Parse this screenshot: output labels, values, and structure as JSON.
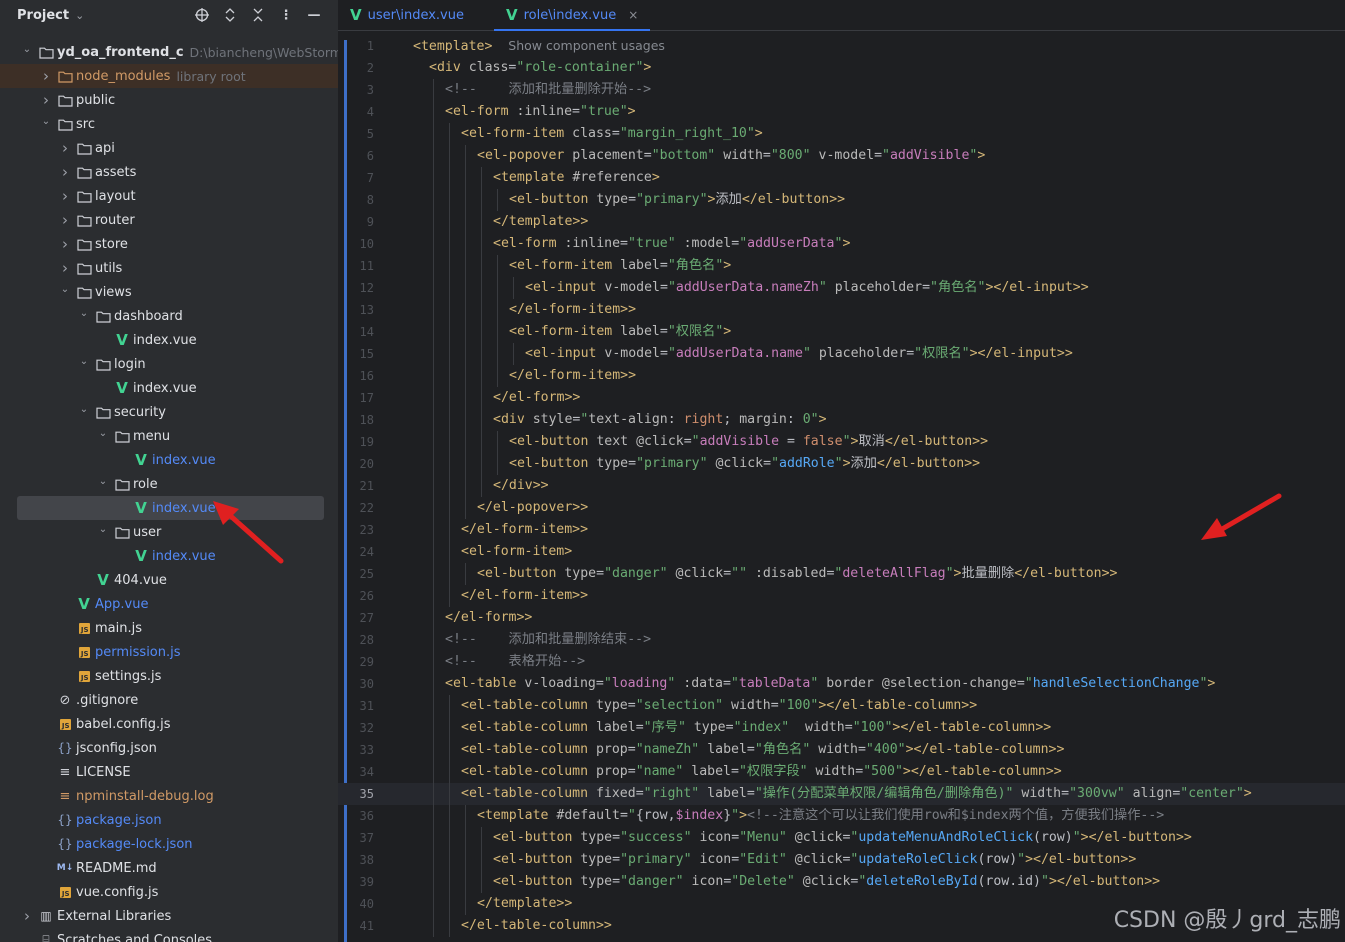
{
  "project_panel": {
    "title": "Project",
    "tools": [
      "crosshair-icon",
      "expand-icon",
      "collapse-icon",
      "more-icon",
      "minimize-icon"
    ]
  },
  "tree": [
    {
      "depth": 0,
      "arrow": "down",
      "icon": "folder",
      "label": "yd_oa_frontend_c",
      "sub": "D:\\biancheng\\WebStormProj",
      "bold": true
    },
    {
      "depth": 1,
      "arrow": "right",
      "icon": "folder-excluded",
      "label": "node_modules",
      "sub": "library root",
      "variant": "excluded"
    },
    {
      "depth": 1,
      "arrow": "right",
      "icon": "folder",
      "label": "public"
    },
    {
      "depth": 1,
      "arrow": "down",
      "icon": "folder",
      "label": "src"
    },
    {
      "depth": 2,
      "arrow": "right",
      "icon": "folder",
      "label": "api"
    },
    {
      "depth": 2,
      "arrow": "right",
      "icon": "folder",
      "label": "assets"
    },
    {
      "depth": 2,
      "arrow": "right",
      "icon": "folder",
      "label": "layout"
    },
    {
      "depth": 2,
      "arrow": "right",
      "icon": "folder",
      "label": "router"
    },
    {
      "depth": 2,
      "arrow": "right",
      "icon": "folder",
      "label": "store"
    },
    {
      "depth": 2,
      "arrow": "right",
      "icon": "folder",
      "label": "utils"
    },
    {
      "depth": 2,
      "arrow": "down",
      "icon": "folder",
      "label": "views"
    },
    {
      "depth": 3,
      "arrow": "down",
      "icon": "folder",
      "label": "dashboard"
    },
    {
      "depth": 4,
      "arrow": "none",
      "icon": "vue",
      "label": "index.vue"
    },
    {
      "depth": 3,
      "arrow": "down",
      "icon": "folder",
      "label": "login"
    },
    {
      "depth": 4,
      "arrow": "none",
      "icon": "vue",
      "label": "index.vue"
    },
    {
      "depth": 3,
      "arrow": "down",
      "icon": "folder",
      "label": "security"
    },
    {
      "depth": 4,
      "arrow": "down",
      "icon": "folder",
      "label": "menu"
    },
    {
      "depth": 5,
      "arrow": "none",
      "icon": "vue",
      "label": "index.vue",
      "color": "blue"
    },
    {
      "depth": 4,
      "arrow": "down",
      "icon": "folder",
      "label": "role"
    },
    {
      "depth": 5,
      "arrow": "none",
      "icon": "vue",
      "label": "index.vue",
      "color": "blue",
      "selected": true
    },
    {
      "depth": 4,
      "arrow": "down",
      "icon": "folder",
      "label": "user"
    },
    {
      "depth": 5,
      "arrow": "none",
      "icon": "vue",
      "label": "index.vue",
      "color": "blue"
    },
    {
      "depth": 3,
      "arrow": "none",
      "icon": "vue",
      "label": "404.vue"
    },
    {
      "depth": 2,
      "arrow": "none",
      "icon": "vue",
      "label": "App.vue",
      "color": "blue"
    },
    {
      "depth": 2,
      "arrow": "none",
      "icon": "js",
      "label": "main.js"
    },
    {
      "depth": 2,
      "arrow": "none",
      "icon": "js",
      "label": "permission.js",
      "color": "blue"
    },
    {
      "depth": 2,
      "arrow": "none",
      "icon": "js",
      "label": "settings.js"
    },
    {
      "depth": 1,
      "arrow": "none",
      "icon": "ignore",
      "label": ".gitignore"
    },
    {
      "depth": 1,
      "arrow": "none",
      "icon": "js",
      "label": "babel.config.js"
    },
    {
      "depth": 1,
      "arrow": "none",
      "icon": "json",
      "label": "jsconfig.json"
    },
    {
      "depth": 1,
      "arrow": "none",
      "icon": "text",
      "label": "LICENSE"
    },
    {
      "depth": 1,
      "arrow": "none",
      "icon": "log",
      "label": "npminstall-debug.log",
      "color": "orange"
    },
    {
      "depth": 1,
      "arrow": "none",
      "icon": "json",
      "label": "package.json",
      "color": "blue"
    },
    {
      "depth": 1,
      "arrow": "none",
      "icon": "json",
      "label": "package-lock.json",
      "color": "blue"
    },
    {
      "depth": 1,
      "arrow": "none",
      "icon": "md",
      "label": "README.md"
    },
    {
      "depth": 1,
      "arrow": "none",
      "icon": "js",
      "label": "vue.config.js"
    },
    {
      "depth": 0,
      "arrow": "right",
      "icon": "library",
      "label": "External Libraries"
    },
    {
      "depth": 0,
      "arrow": "none",
      "icon": "scratch",
      "label": "Scratches and Consoles"
    }
  ],
  "tabs": [
    {
      "label": "user\\index.vue",
      "active": false
    },
    {
      "label": "role\\index.vue",
      "active": true,
      "close": "×"
    }
  ],
  "editor": {
    "current_line": 35,
    "lines": [
      {
        "n": 1,
        "indent": 0,
        "html": "<t><template></t>  <h>Show component usages</h>"
      },
      {
        "n": 2,
        "indent": 1,
        "html": "<t><div </t><a>class</a><p>=</p><s>\"role-container\"</s><t>></t>"
      },
      {
        "n": 3,
        "indent": 2,
        "html": "<c><!--    添加和批量删除开始--></c>"
      },
      {
        "n": 4,
        "indent": 2,
        "html": "<t><el-form </t><a>:inline</a><p>=</p><s>\"true\"</s><t>></t>"
      },
      {
        "n": 5,
        "indent": 3,
        "html": "<t><el-form-item </t><a>class</a><p>=</p><s>\"margin_right_10\"</s><t>></t>"
      },
      {
        "n": 6,
        "indent": 4,
        "html": "<t><el-popover </t><a>placement</a><p>=</p><s>\"bottom\"</s> <a>width</a><p>=</p><s>\"800\"</s> <a>v-model</a><p>=</p><s>\"</s><v>addVisible</v><s>\"</s><t>></t>"
      },
      {
        "n": 7,
        "indent": 5,
        "html": "<t><template </t><a>#reference</a><t>></t>"
      },
      {
        "n": 8,
        "indent": 6,
        "html": "<t><el-button </t><a>type</a><p>=</p><s>\"primary\"</s><t>></t><x>添加</x><t></el-button></t><t>></t>"
      },
      {
        "n": 9,
        "indent": 5,
        "html": "<t></template></t><t>></t>"
      },
      {
        "n": 10,
        "indent": 5,
        "html": "<t><el-form </t><a>:inline</a><p>=</p><s>\"true\"</s> <a>:model</a><p>=</p><s>\"</s><v>addUserData</v><s>\"</s><t>></t>"
      },
      {
        "n": 11,
        "indent": 6,
        "html": "<t><el-form-item </t><a>label</a><p>=</p><s>\"角色名\"</s><t>></t>"
      },
      {
        "n": 12,
        "indent": 7,
        "html": "<t><el-input </t><a>v-model</a><p>=</p><s>\"</s><v>addUserData.nameZh</v><s>\"</s> <a>placeholder</a><p>=</p><s>\"角色名\"</s><t>></el-input></t><t>></t>"
      },
      {
        "n": 13,
        "indent": 6,
        "html": "<t></el-form-item></t><t>></t>"
      },
      {
        "n": 14,
        "indent": 6,
        "html": "<t><el-form-item </t><a>label</a><p>=</p><s>\"权限名\"</s><t>></t>"
      },
      {
        "n": 15,
        "indent": 7,
        "html": "<t><el-input </t><a>v-model</a><p>=</p><s>\"</s><v>addUserData.name</v><s>\"</s> <a>placeholder</a><p>=</p><s>\"权限名\"</s><t>></el-input></t><t>></t>"
      },
      {
        "n": 16,
        "indent": 6,
        "html": "<t></el-form-item></t><t>></t>"
      },
      {
        "n": 17,
        "indent": 5,
        "html": "<t></el-form></t><t>></t>"
      },
      {
        "n": 18,
        "indent": 5,
        "html": "<t><div </t><a>style</a><p>=</p><s>\"</s><a>text-align</a><p>: </p><k>right</k><p>; </p><a>margin</a><p>: </p><s>0\"</s><t>></t>"
      },
      {
        "n": 19,
        "indent": 6,
        "html": "<t><el-button </t><a>text</a> <a>@click</a><p>=</p><s>\"</s><v>addVisible</v> <p>= </p><k>false</k><s>\"</s><t>></t><x>取消</x><t></el-button></t><t>></t>"
      },
      {
        "n": 20,
        "indent": 6,
        "html": "<t><el-button </t><a>type</a><p>=</p><s>\"primary\"</s> <a>@click</a><p>=</p><s>\"</s><f>addRole</f><s>\"</s><t>></t><x>添加</x><t></el-button></t><t>></t>"
      },
      {
        "n": 21,
        "indent": 5,
        "html": "<t></div></t><t>></t>"
      },
      {
        "n": 22,
        "indent": 4,
        "html": "<t></el-popover></t><t>></t>"
      },
      {
        "n": 23,
        "indent": 3,
        "html": "<t></el-form-item></t><t>></t>"
      },
      {
        "n": 24,
        "indent": 3,
        "html": "<t><el-form-item></t>"
      },
      {
        "n": 25,
        "indent": 4,
        "html": "<t><el-button </t><a>type</a><p>=</p><s>\"danger\"</s> <a>@click</a><p>=</p><s>\"\"</s> <a>:disabled</a><p>=</p><s>\"</s><v>deleteAllFlag</v><s>\"</s><t>></t><x>批量删除</x><t></el-button></t><t>></t>"
      },
      {
        "n": 26,
        "indent": 3,
        "html": "<t></el-form-item></t><t>></t>"
      },
      {
        "n": 27,
        "indent": 2,
        "html": "<t></el-form></t><t>></t>"
      },
      {
        "n": 28,
        "indent": 2,
        "html": "<c><!--    添加和批量删除结束--></c>"
      },
      {
        "n": 29,
        "indent": 2,
        "html": "<c><!--    表格开始--></c>"
      },
      {
        "n": 30,
        "indent": 2,
        "html": "<t><el-table </t><a>v-loading</a><p>=</p><s>\"</s><v>loading</v><s>\"</s> <a>:data</a><p>=</p><s>\"</s><v>tableData</v><s>\"</s> <a>border</a> <a>@selection-change</a><p>=</p><s>\"</s><f>handleSelectionChange</f><s>\"</s><t>></t>"
      },
      {
        "n": 31,
        "indent": 3,
        "html": "<t><el-table-column </t><a>type</a><p>=</p><s>\"selection\"</s> <a>width</a><p>=</p><s>\"100\"</s><t>></el-table-column></t><t>></t>"
      },
      {
        "n": 32,
        "indent": 3,
        "html": "<t><el-table-column </t><a>label</a><p>=</p><s>\"序号\"</s> <a>type</a><p>=</p><s>\"index\"</s>  <a>width</a><p>=</p><s>\"100\"</s><t>></el-table-column></t><t>></t>"
      },
      {
        "n": 33,
        "indent": 3,
        "html": "<t><el-table-column </t><a>prop</a><p>=</p><s>\"nameZh\"</s> <a>label</a><p>=</p><s>\"角色名\"</s> <a>width</a><p>=</p><s>\"400\"</s><t>></el-table-column></t><t>></t>"
      },
      {
        "n": 34,
        "indent": 3,
        "html": "<t><el-table-column </t><a>prop</a><p>=</p><s>\"name\"</s> <a>label</a><p>=</p><s>\"权限字段\"</s> <a>width</a><p>=</p><s>\"500\"</s><t>></el-table-column></t><t>></t>"
      },
      {
        "n": 35,
        "indent": 3,
        "html": "<t><el-table-column </t><a>fixed</a><p>=</p><s>\"right\"</s> <a>label</a><p>=</p><s>\"操作(分配菜单权限/编辑角色/删除角色)\"</s> <a>width</a><p>=</p><s>\"300vw\"</s> <a>align</a><p>=</p><s>\"center\"</s><t>></t>"
      },
      {
        "n": 36,
        "indent": 4,
        "html": "<t><template </t><a>#default</a><p>=</p><s>\"</s><p>{row,</p><v>$index</v><p>}</p><s>\"</s><t>></t><c><!--注意这个可以让我们使用row和$index两个值，方便我们操作--></c>"
      },
      {
        "n": 37,
        "indent": 5,
        "html": "<t><el-button </t><a>type</a><p>=</p><s>\"success\"</s> <a>icon</a><p>=</p><s>\"Menu\"</s> <a>@click</a><p>=</p><s>\"</s><f>updateMenuAndRoleClick</f><p>(row)</p><s>\"</s><t>></el-button></t><t>></t>"
      },
      {
        "n": 38,
        "indent": 5,
        "html": "<t><el-button </t><a>type</a><p>=</p><s>\"primary\"</s> <a>icon</a><p>=</p><s>\"Edit\"</s> <a>@click</a><p>=</p><s>\"</s><f>updateRoleClick</f><p>(row)</p><s>\"</s><t>></el-button></t><t>></t>"
      },
      {
        "n": 39,
        "indent": 5,
        "html": "<t><el-button </t><a>type</a><p>=</p><s>\"danger\"</s> <a>icon</a><p>=</p><s>\"Delete\"</s> <a>@click</a><p>=</p><s>\"</s><f>deleteRoleById</f><p>(row.id)</p><s>\"</s><t>></el-button></t><t>></t>"
      },
      {
        "n": 40,
        "indent": 4,
        "html": "<t></template></t><t>></t>"
      },
      {
        "n": 41,
        "indent": 3,
        "html": "<t></el-table-column></t><t>></t>"
      }
    ]
  },
  "watermark": "CSDN @殷丿grd_志鹏"
}
